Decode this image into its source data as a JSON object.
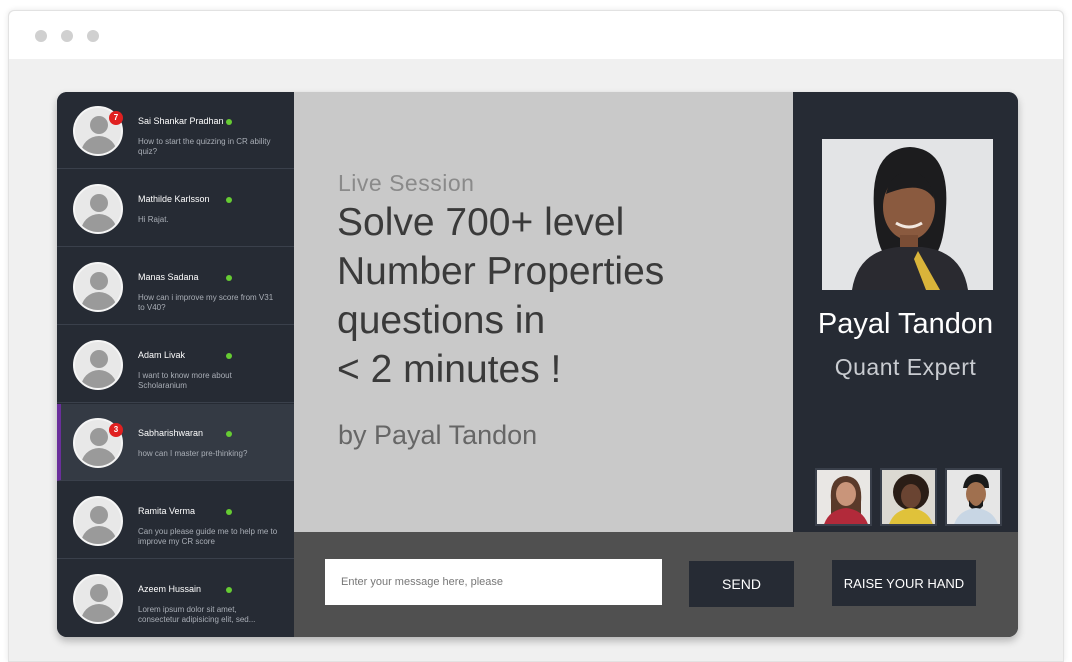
{
  "contacts": [
    {
      "name": "Sai Shankar Pradhan",
      "message": "How to start the quizzing in CR ability quiz?",
      "badge": "7"
    },
    {
      "name": "Mathilde Karlsson",
      "message": "Hi Rajat.",
      "badge": ""
    },
    {
      "name": "Manas Sadana",
      "message": "How can i improve my score from V31 to V40?",
      "badge": ""
    },
    {
      "name": "Adam Livak",
      "message": "I want to know more about Scholaranium",
      "badge": ""
    },
    {
      "name": "Sabharishwaran",
      "message": "how can I master pre-thinking?",
      "badge": "3"
    },
    {
      "name": "Ramita Verma",
      "message": "Can you please guide me to help me to improve my CR score",
      "badge": ""
    },
    {
      "name": "Azeem Hussain",
      "message": "Lorem ipsum dolor sit amet, consectetur adipisicing elit, sed...",
      "badge": ""
    }
  ],
  "session": {
    "label": "Live Session",
    "title_lines": [
      "Solve 700+ level",
      "Number Properties",
      "questions in",
      "< 2 minutes !"
    ],
    "byline": "by Payal Tandon"
  },
  "presenter": {
    "name": "Payal Tandon",
    "role": "Quant Expert"
  },
  "chat": {
    "placeholder": "Enter your message here, please",
    "send_label": "SEND",
    "raise_label": "RAISE YOUR HAND"
  },
  "colors": {
    "sidebar": "#262b34",
    "slide": "#c9c9c9",
    "bottom_bar": "#505050",
    "online": "#66cc33",
    "badge": "#e02020",
    "active_marker": "#6a2f9b"
  }
}
